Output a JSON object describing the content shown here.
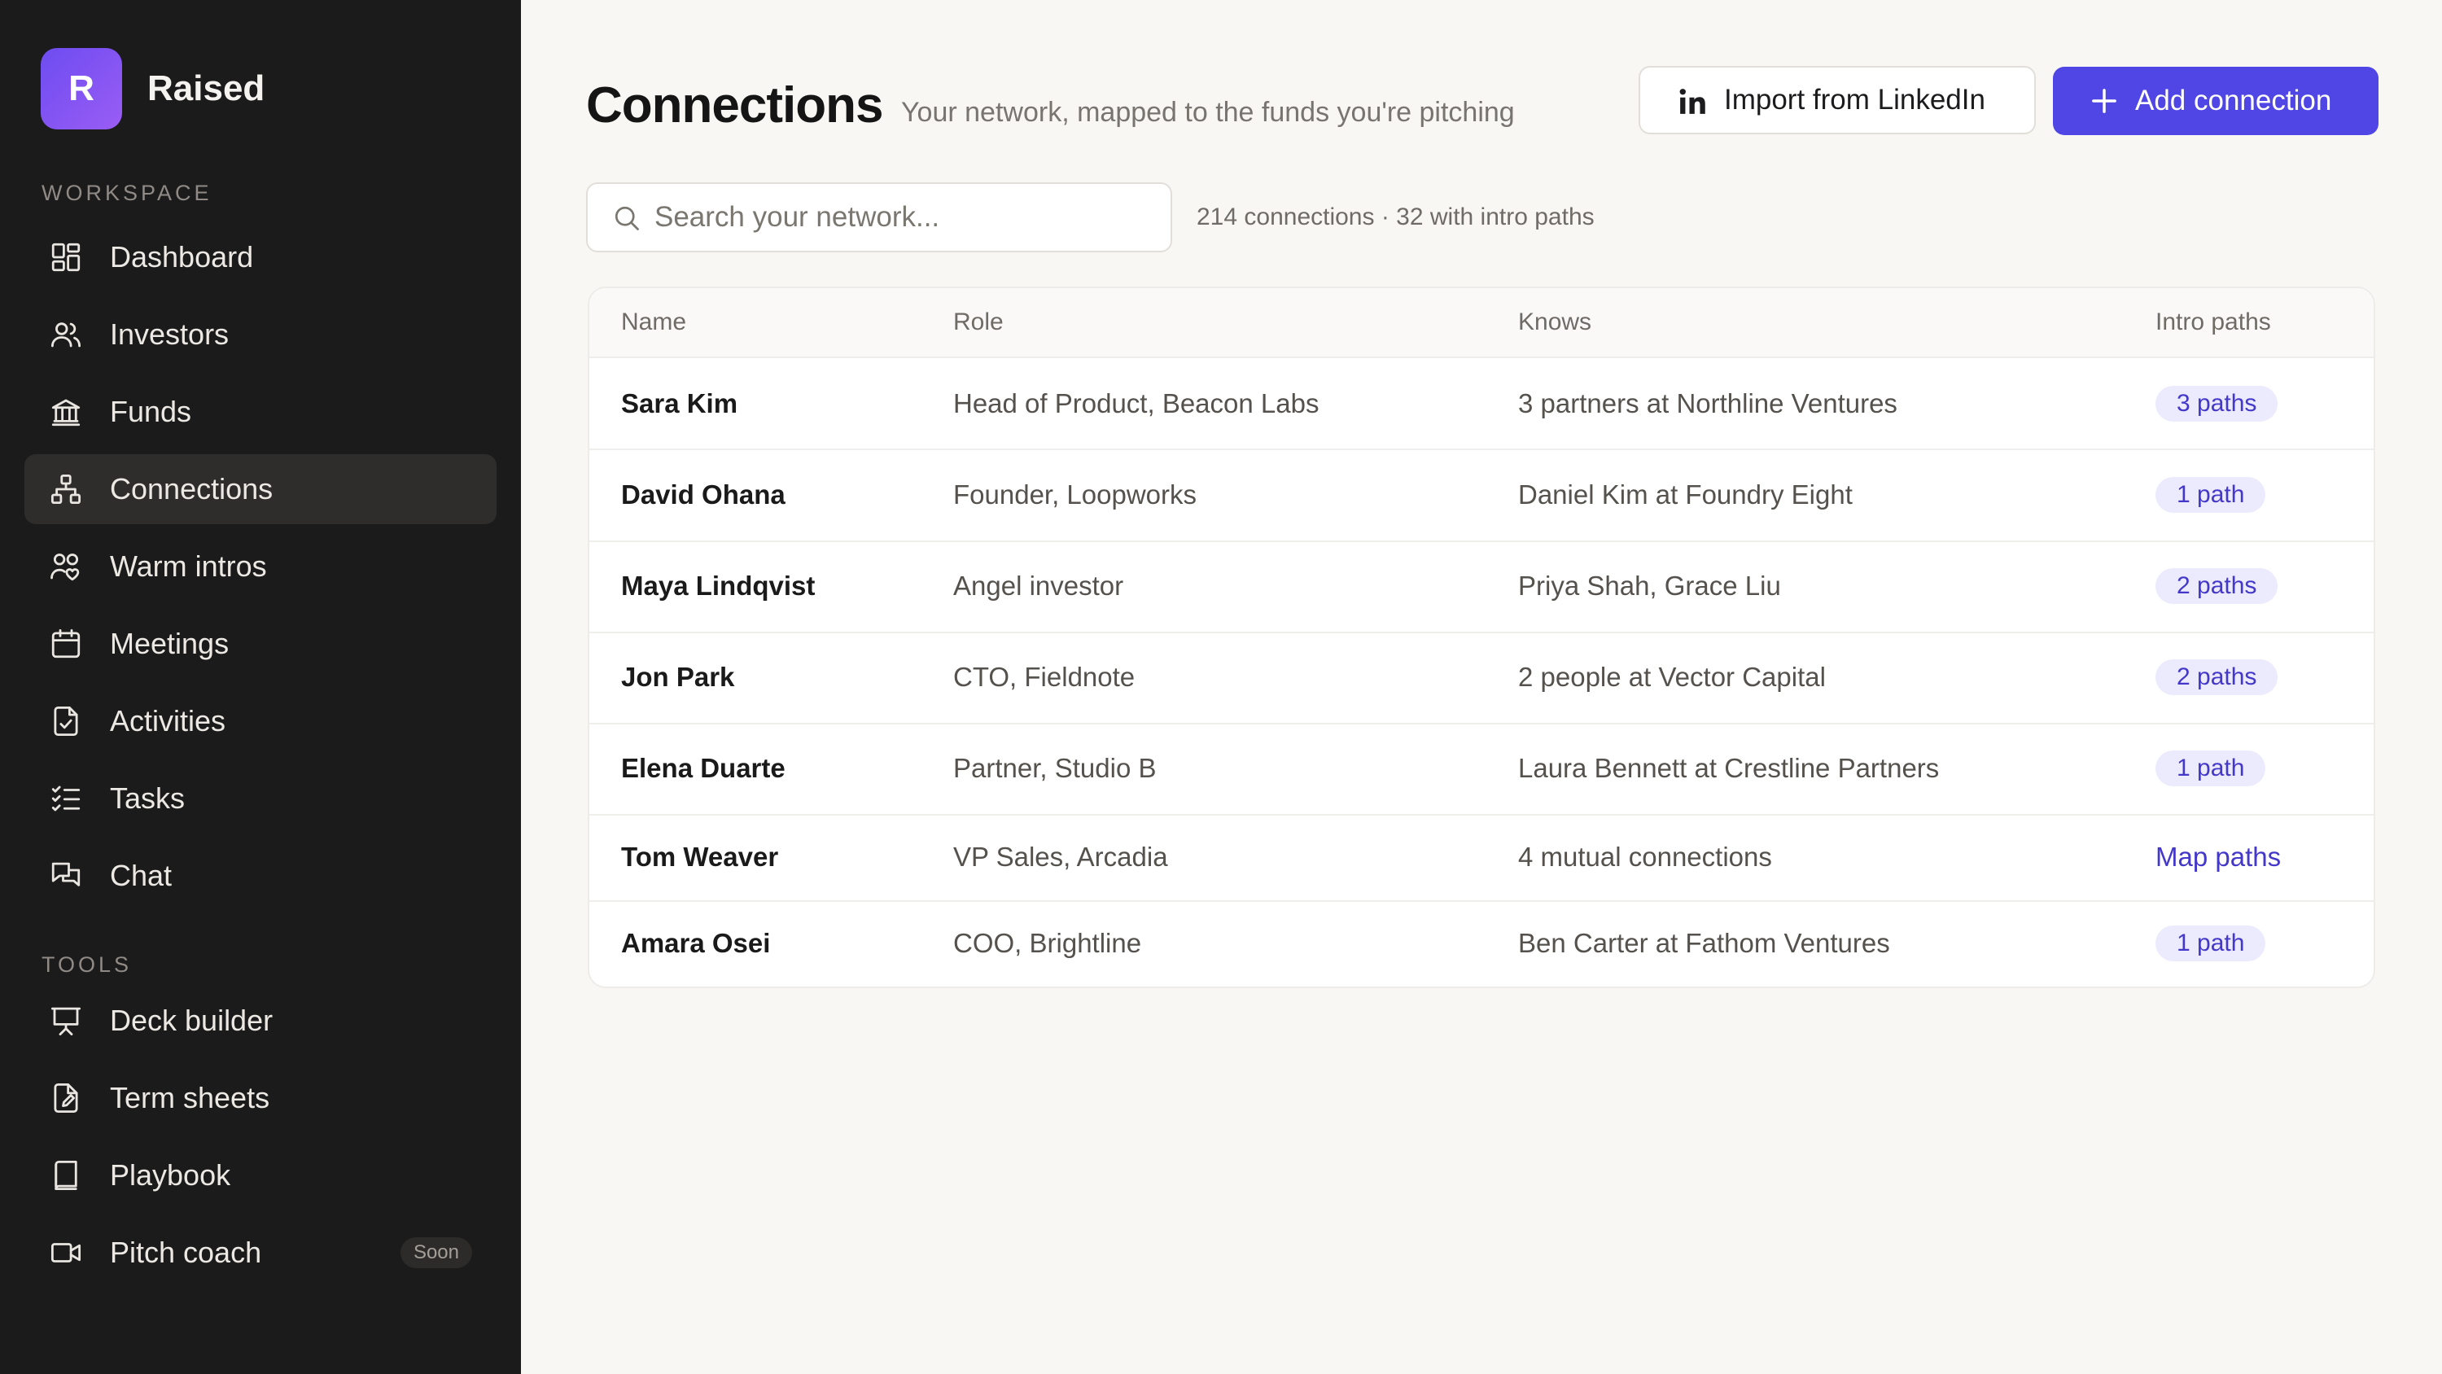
{
  "brand": {
    "logo_letter": "R",
    "name": "Raised",
    "accent": "#6d4cf0"
  },
  "sidebar": {
    "workspace_label": "WORKSPACE",
    "tools_label": "TOOLS",
    "workspace_items": [
      {
        "label": "Dashboard",
        "icon": "dashboard-grid-icon"
      },
      {
        "label": "Investors",
        "icon": "users-icon"
      },
      {
        "label": "Funds",
        "icon": "bank-icon"
      },
      {
        "label": "Connections",
        "icon": "network-icon",
        "active": true
      },
      {
        "label": "Warm intros",
        "icon": "people-heart-icon"
      },
      {
        "label": "Meetings",
        "icon": "calendar-icon"
      },
      {
        "label": "Activities",
        "icon": "clipboard-check-icon"
      },
      {
        "label": "Tasks",
        "icon": "checklist-icon"
      },
      {
        "label": "Chat",
        "icon": "chat-bubbles-icon"
      }
    ],
    "tool_items": [
      {
        "label": "Deck builder",
        "icon": "presentation-icon"
      },
      {
        "label": "Term sheets",
        "icon": "document-edit-icon"
      },
      {
        "label": "Playbook",
        "icon": "book-icon"
      },
      {
        "label": "Pitch coach",
        "icon": "video-camera-icon",
        "badge": "Soon"
      }
    ]
  },
  "header": {
    "title": "Connections",
    "subtitle": "Your network, mapped to the funds you're pitching",
    "import_button": "Import from LinkedIn",
    "add_button": "Add connection",
    "primary_color": "#4f46e5"
  },
  "search": {
    "placeholder": "Search your network...",
    "value": "",
    "summary": "214 connections · 32 with intro paths"
  },
  "table": {
    "columns": [
      "Name",
      "Role",
      "Knows",
      "Intro paths"
    ],
    "rows": [
      {
        "name": "Sara Kim",
        "role": "Head of Product, Beacon Labs",
        "knows": "3 partners at Northline Ventures",
        "paths": "3 paths",
        "kind": "badge"
      },
      {
        "name": "David Ohana",
        "role": "Founder, Loopworks",
        "knows": "Daniel Kim at Foundry Eight",
        "paths": "1 path",
        "kind": "badge"
      },
      {
        "name": "Maya Lindqvist",
        "role": "Angel investor",
        "knows": "Priya Shah, Grace Liu",
        "paths": "2 paths",
        "kind": "badge"
      },
      {
        "name": "Jon Park",
        "role": "CTO, Fieldnote",
        "knows": "2 people at Vector Capital",
        "paths": "2 paths",
        "kind": "badge"
      },
      {
        "name": "Elena Duarte",
        "role": "Partner, Studio B",
        "knows": "Laura Bennett at Crestline Partners",
        "paths": "1 path",
        "kind": "badge"
      },
      {
        "name": "Tom Weaver",
        "role": "VP Sales, Arcadia",
        "knows": "4 mutual connections",
        "paths": "Map paths",
        "kind": "link"
      },
      {
        "name": "Amara Osei",
        "role": "COO, Brightline",
        "knows": "Ben Carter at Fathom Ventures",
        "paths": "1 path",
        "kind": "badge"
      }
    ]
  }
}
